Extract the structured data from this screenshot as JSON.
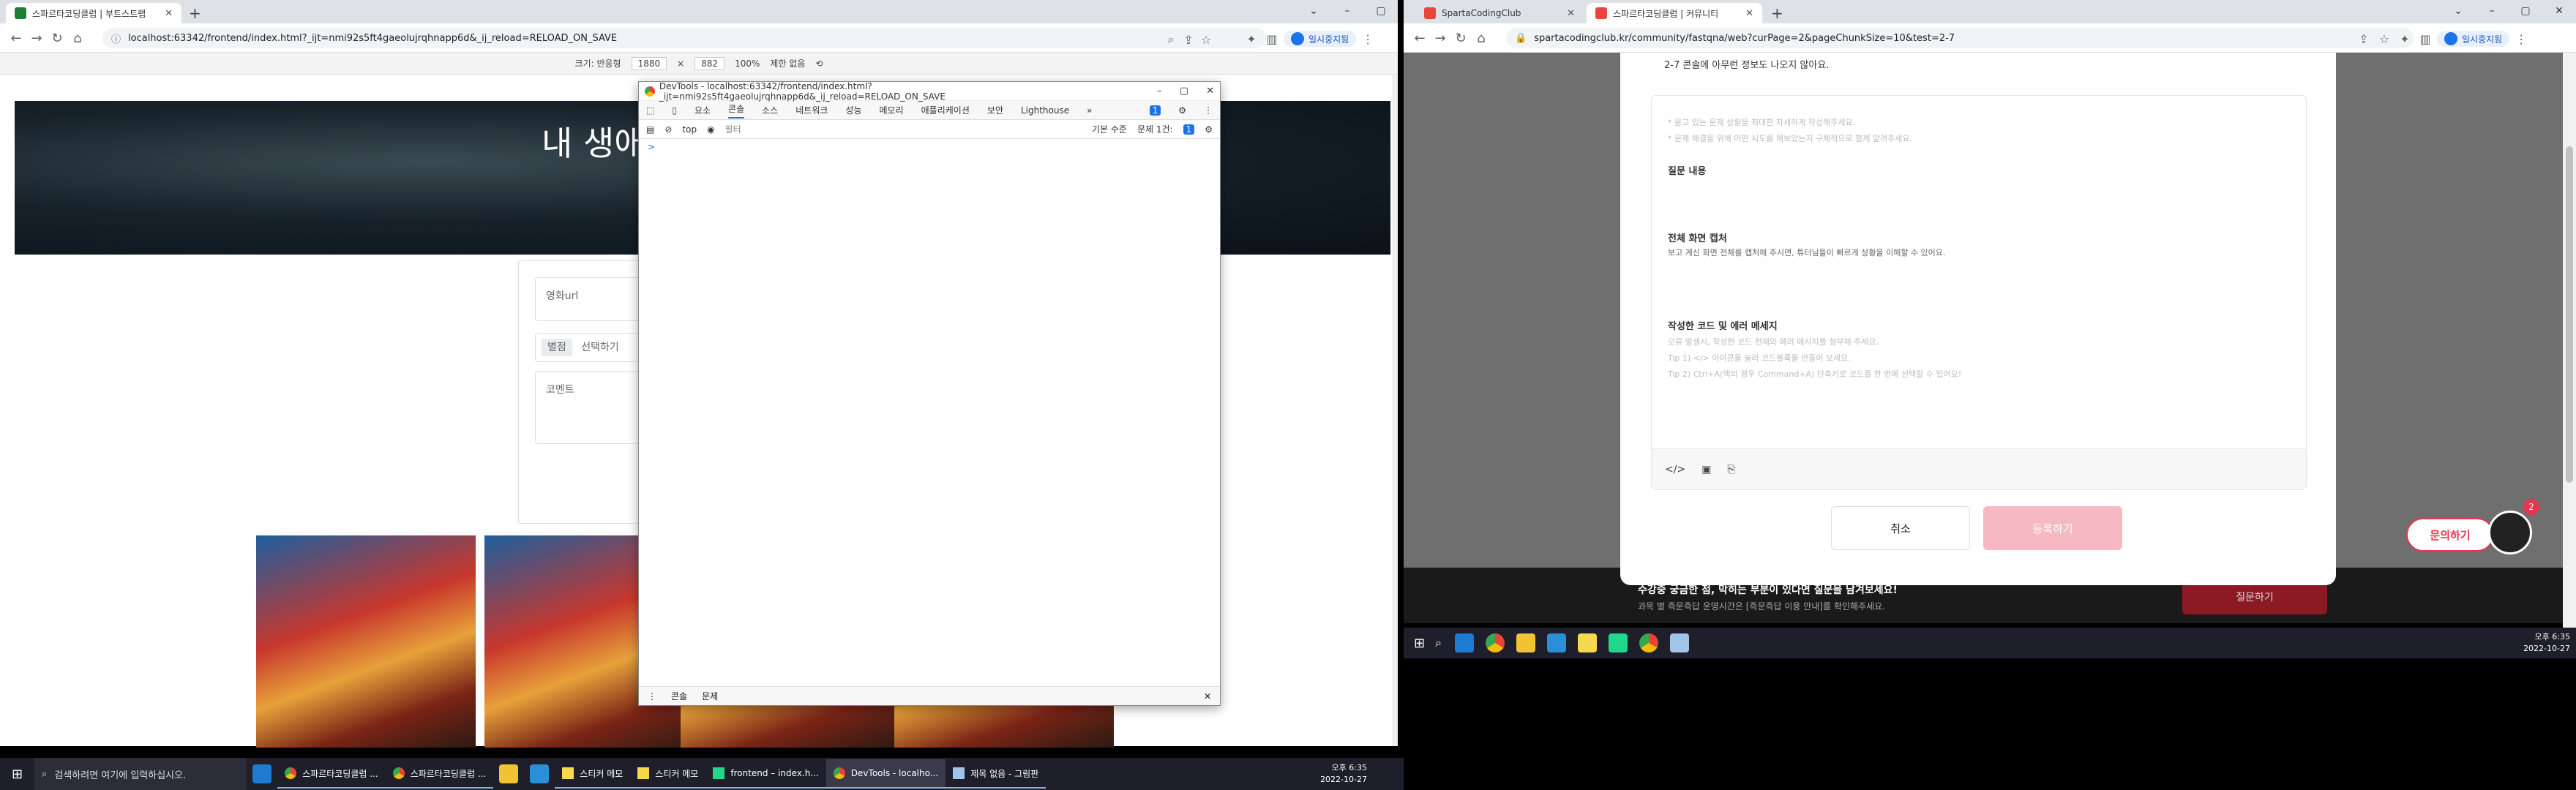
{
  "left_browser": {
    "tabs": [
      {
        "title": "스파르타코딩클럽 | 부트스트랩",
        "color": "#1e7e34"
      }
    ],
    "address": "localhost:63342/frontend/index.html?_ijt=nmi92s5ft4gaeolujrqhnapp6d&_ij_reload=RELOAD_ON_SAVE",
    "sync_label": "일시중지됨",
    "device_bar": {
      "size_label": "크기: 반응형",
      "width": "1880",
      "height": "882",
      "zoom": "100%",
      "throttle": "제한 없음"
    }
  },
  "left_page": {
    "hero_title": "내 생애",
    "field_url": "영화url",
    "field_star_label": "별점",
    "field_star_select": "선택하기",
    "field_comment": "코멘트"
  },
  "devtools": {
    "title": "DevTools - localhost:63342/frontend/index.html?_ijt=nmi92s5ft4gaeolujrqhnapp6d&_ij_reload=RELOAD_ON_SAVE",
    "tabs": [
      "요소",
      "콘솔",
      "소스",
      "네트워크",
      "성능",
      "메모리",
      "애플리케이션",
      "보안",
      "Lighthouse"
    ],
    "more": "»",
    "badge": "1",
    "context": "top",
    "filter_placeholder": "필터",
    "levels": "기본 수준",
    "issues": "문제 1건:",
    "issues_count": "1",
    "prompt": ">",
    "drawer_tabs": [
      "콘솔",
      "문제"
    ]
  },
  "right_browser": {
    "tabs": [
      {
        "title": "SpartaCodingClub",
        "color": "#e8453c"
      },
      {
        "title": "스파르타코딩클럽 | 커뮤니티",
        "color": "#e8453c"
      }
    ],
    "address": "spartacodingclub.kr/community/fastqna/web?curPage=2&pageChunkSize=10&test=2-7",
    "sync_label": "일시중지됨"
  },
  "right_page": {
    "top_text": "2-7 콘솔에 아무런 정보도 나오지 않아요.",
    "placeholder_line1": "* 묻고 있는 문제 상황을 최대한 자세하게 작성해주세요.",
    "placeholder_line2": "* 문제 해결을 위해 어떤 시도를 해보았는지 구체적으로 함께 알려주세요.",
    "section_question": "질문 내용",
    "section_screenshot": "전체 화면 캡처",
    "screenshot_desc": "보고 계신 화면 전체를 캡처해 주시면, 튜터님들이 빠르게 상황을 이해할 수 있어요.",
    "section_code": "작성한 코드 및 에러 메세지",
    "code_hint1": "오류 발생시, 작성한 코드 전체와 에러 메시지를 첨부해 주세요.",
    "code_hint2": "Tip 1) </> 아이콘을 눌러 코드블록을 만들어 보세요.",
    "code_hint3": "Tip 2) Ctrl+A(맥의 경우 Command+A) 단축키로 코드를 한 번에 선택할 수 있어요!",
    "cancel": "취소",
    "submit": "등록하기",
    "inquiry": "문의하기",
    "banner_title": "수강중 궁금한 점, 막히는 부분이 있다면 질문을 남겨보세요!",
    "banner_sub": "과목 별 즉문즉답 운영시간은 [즉문즉답 이용 안내]를 확인해주세요.",
    "banner_btn": "질문하기",
    "notif_count": "2",
    "accent": "#e8344e"
  },
  "taskbar_left": {
    "search_placeholder": "검색하려면 여기에 입력하십시오.",
    "apps": [
      "스파르타코딩클럽 ...",
      "스파르타코딩클럽 ...",
      "스티커 메모",
      "스티커 메모",
      "frontend – index.h...",
      "DevTools - localho...",
      "제목 없음 - 그림판"
    ],
    "time": "오후 6:35",
    "date": "2022-10-27"
  },
  "taskbar_right": {
    "time": "오후 6:35",
    "date": "2022-10-27"
  }
}
